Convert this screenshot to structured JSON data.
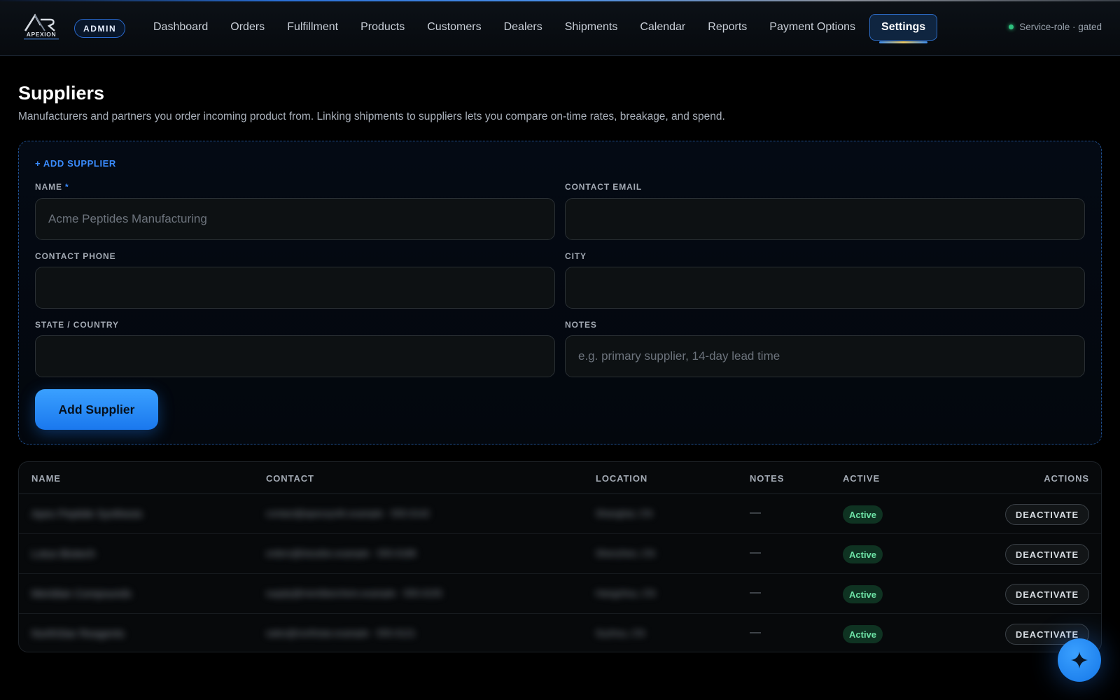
{
  "header": {
    "logo_text": "APEXION",
    "admin_badge": "ADMIN",
    "nav": [
      {
        "label": "Dashboard",
        "active": false
      },
      {
        "label": "Orders",
        "active": false
      },
      {
        "label": "Fulfillment",
        "active": false
      },
      {
        "label": "Products",
        "active": false
      },
      {
        "label": "Customers",
        "active": false
      },
      {
        "label": "Dealers",
        "active": false
      },
      {
        "label": "Shipments",
        "active": false
      },
      {
        "label": "Calendar",
        "active": false
      },
      {
        "label": "Reports",
        "active": false
      },
      {
        "label": "Payment Options",
        "active": false
      },
      {
        "label": "Settings",
        "active": true
      }
    ],
    "service_status": "Service-role · gated",
    "status_color": "#2ec27e"
  },
  "page": {
    "title": "Suppliers",
    "subtitle": "Manufacturers and partners you order incoming product from. Linking shipments to suppliers lets you compare on-time rates, breakage, and spend."
  },
  "form": {
    "heading": "+ ADD SUPPLIER",
    "required_mark": "*",
    "fields": {
      "name": {
        "label": "NAME",
        "value": "",
        "placeholder": "Acme Peptides Manufacturing"
      },
      "contact_email": {
        "label": "CONTACT EMAIL",
        "value": "",
        "placeholder": ""
      },
      "contact_phone": {
        "label": "CONTACT PHONE",
        "value": "",
        "placeholder": ""
      },
      "city": {
        "label": "CITY",
        "value": "",
        "placeholder": ""
      },
      "state_country": {
        "label": "STATE / COUNTRY",
        "value": "",
        "placeholder": ""
      },
      "notes": {
        "label": "NOTES",
        "value": "",
        "placeholder": "e.g. primary supplier, 14-day lead time"
      }
    },
    "submit_label": "Add Supplier"
  },
  "table": {
    "columns": [
      "NAME",
      "CONTACT",
      "LOCATION",
      "NOTES",
      "ACTIVE",
      "ACTIONS"
    ],
    "rows": [
      {
        "name": "Apex Peptide Synthesis",
        "contact": "contact@apexsynth.example · 555-0142",
        "location": "Shanghai, CN",
        "notes": "—",
        "active": "Active",
        "action": "DEACTIVATE"
      },
      {
        "name": "Lotus Biotech",
        "contact": "orders@lotusbio.example · 555-0188",
        "location": "Shenzhen, CN",
        "notes": "—",
        "active": "Active",
        "action": "DEACTIVATE"
      },
      {
        "name": "Meridian Compounds",
        "contact": "supply@meridianchem.example · 555-0155",
        "location": "Hangzhou, CN",
        "notes": "—",
        "active": "Active",
        "action": "DEACTIVATE"
      },
      {
        "name": "NorthStar Reagents",
        "contact": "sales@northstar.example · 555-0121",
        "location": "Suzhou, CN",
        "notes": "—",
        "active": "Active",
        "action": "DEACTIVATE"
      }
    ],
    "active_badge_color": "#0f3322"
  },
  "fab": {
    "icon": "sparkle-icon"
  },
  "colors": {
    "accent": "#3a8cff",
    "background": "#000000"
  }
}
